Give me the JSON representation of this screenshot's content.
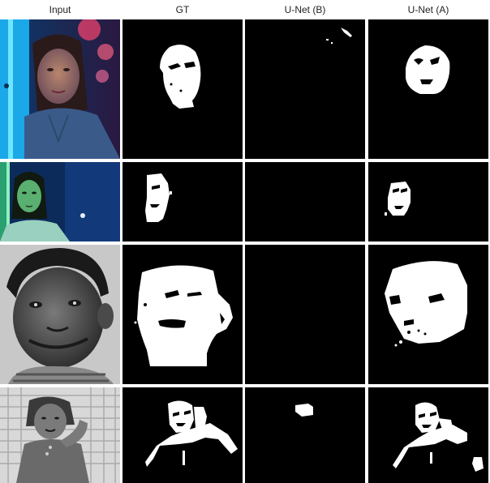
{
  "columns": [
    {
      "key": "input",
      "label": "Input"
    },
    {
      "key": "gt",
      "label": "GT"
    },
    {
      "key": "unet_b",
      "label": "U-Net (B)"
    },
    {
      "key": "unet_a",
      "label": "U-Net (A)"
    }
  ],
  "rows": [
    {
      "subject": "woman-neon-blue"
    },
    {
      "subject": "girl-green-light"
    },
    {
      "subject": "boy-grayscale"
    },
    {
      "subject": "girl-wicker-chair"
    }
  ],
  "colors": {
    "mask_background": "#000000",
    "mask_foreground": "#ffffff",
    "page_background": "#ffffff"
  }
}
